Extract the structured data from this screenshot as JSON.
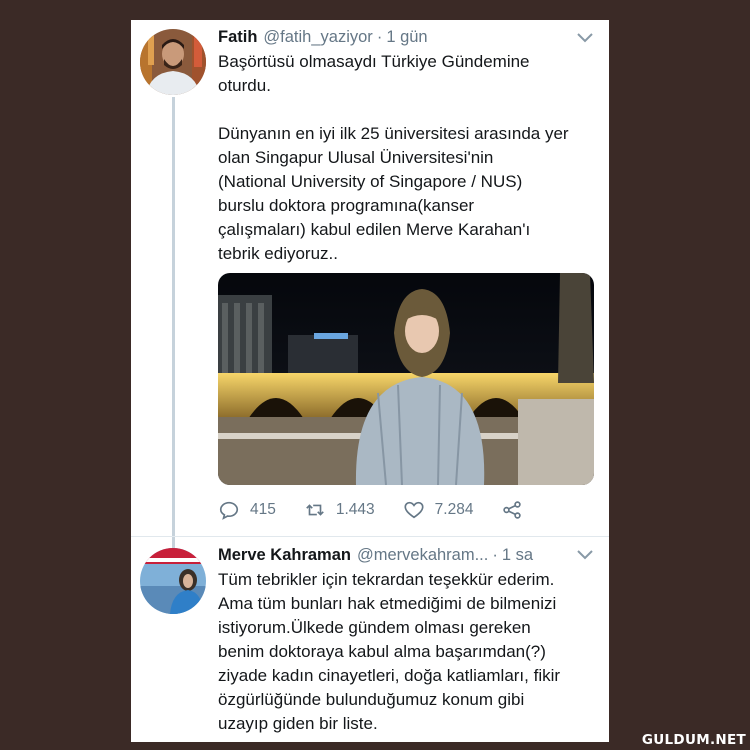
{
  "tweet1": {
    "name": "Fatih",
    "handle": "@fatih_yaziyor",
    "separator": "·",
    "time": "1 gün",
    "text": "Başörtüsü olmasaydı Türkiye Gündemine\noturdu.\n\nDünyanın en iyi ilk 25 üniversitesi arasında yer\nolan Singapur Ulusal Üniversitesi'nin\n(National University of Singapore / NUS)\nburslu doktora programına(kanser\nçalışmaları) kabul edilen Merve Karahan'ı\ntebrik ediyoruz..",
    "actions": {
      "replies": "415",
      "retweets": "1.443",
      "likes": "7.284"
    }
  },
  "tweet2": {
    "name": "Merve Kahraman",
    "handle": "@mervekahram...",
    "separator": "·",
    "time": "1 sa",
    "text": "Tüm tebrikler için tekrardan teşekkür ederim.\nAma tüm bunları hak etmediğimi de bilmenizi\nistiyorum.Ülkede gündem olması gereken\nbenim doktoraya kabul alma başarımdan(?)\nziyade kadın cinayetleri, doğa katliamları, fikir\nözgürlüğünde bulunduğumuz konum gibi\nuzayıp giden bir liste."
  },
  "icons": {
    "reply": "reply-icon",
    "retweet": "retweet-icon",
    "like": "heart-icon",
    "share": "share-icon",
    "menu": "chevron-down-icon"
  },
  "colors": {
    "background": "#3b2a26",
    "card": "#ffffff",
    "text": "#14171a",
    "secondary": "#657786",
    "thread_line": "#c6d2db"
  },
  "watermark": "GULDUM.NET"
}
